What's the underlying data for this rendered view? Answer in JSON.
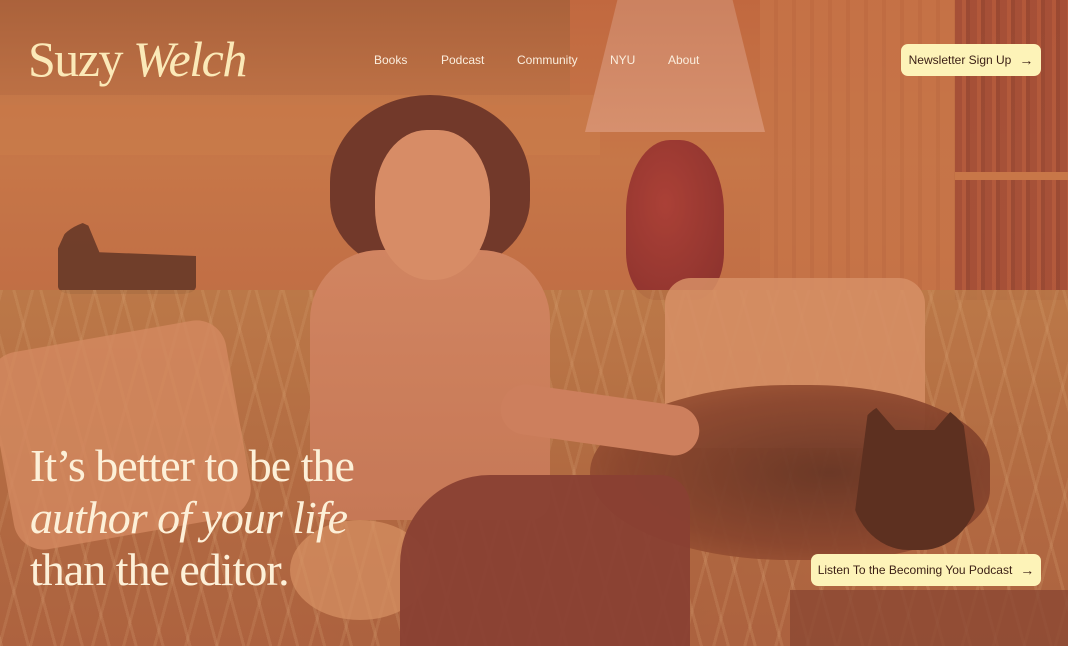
{
  "header": {
    "logo_first": "Suzy",
    "logo_last": "Welch",
    "nav": [
      {
        "label": "Books"
      },
      {
        "label": "Podcast"
      },
      {
        "label": "Community"
      },
      {
        "label": "NYU"
      },
      {
        "label": "About"
      }
    ],
    "newsletter_button": {
      "label": "Newsletter Sign Up",
      "icon": "arrow-right-icon"
    }
  },
  "hero": {
    "headline_line1": "It’s better to be the",
    "headline_line2": "author of your life",
    "headline_line3": "than the editor.",
    "podcast_button": {
      "label": "Listen To the Becoming You Podcast",
      "icon": "arrow-right-icon"
    }
  },
  "colors": {
    "logo_text": "#fbe9b8",
    "button_bg": "#fdf3b8",
    "button_text": "#3a1e14",
    "overlay_tint": "#c06a45"
  }
}
